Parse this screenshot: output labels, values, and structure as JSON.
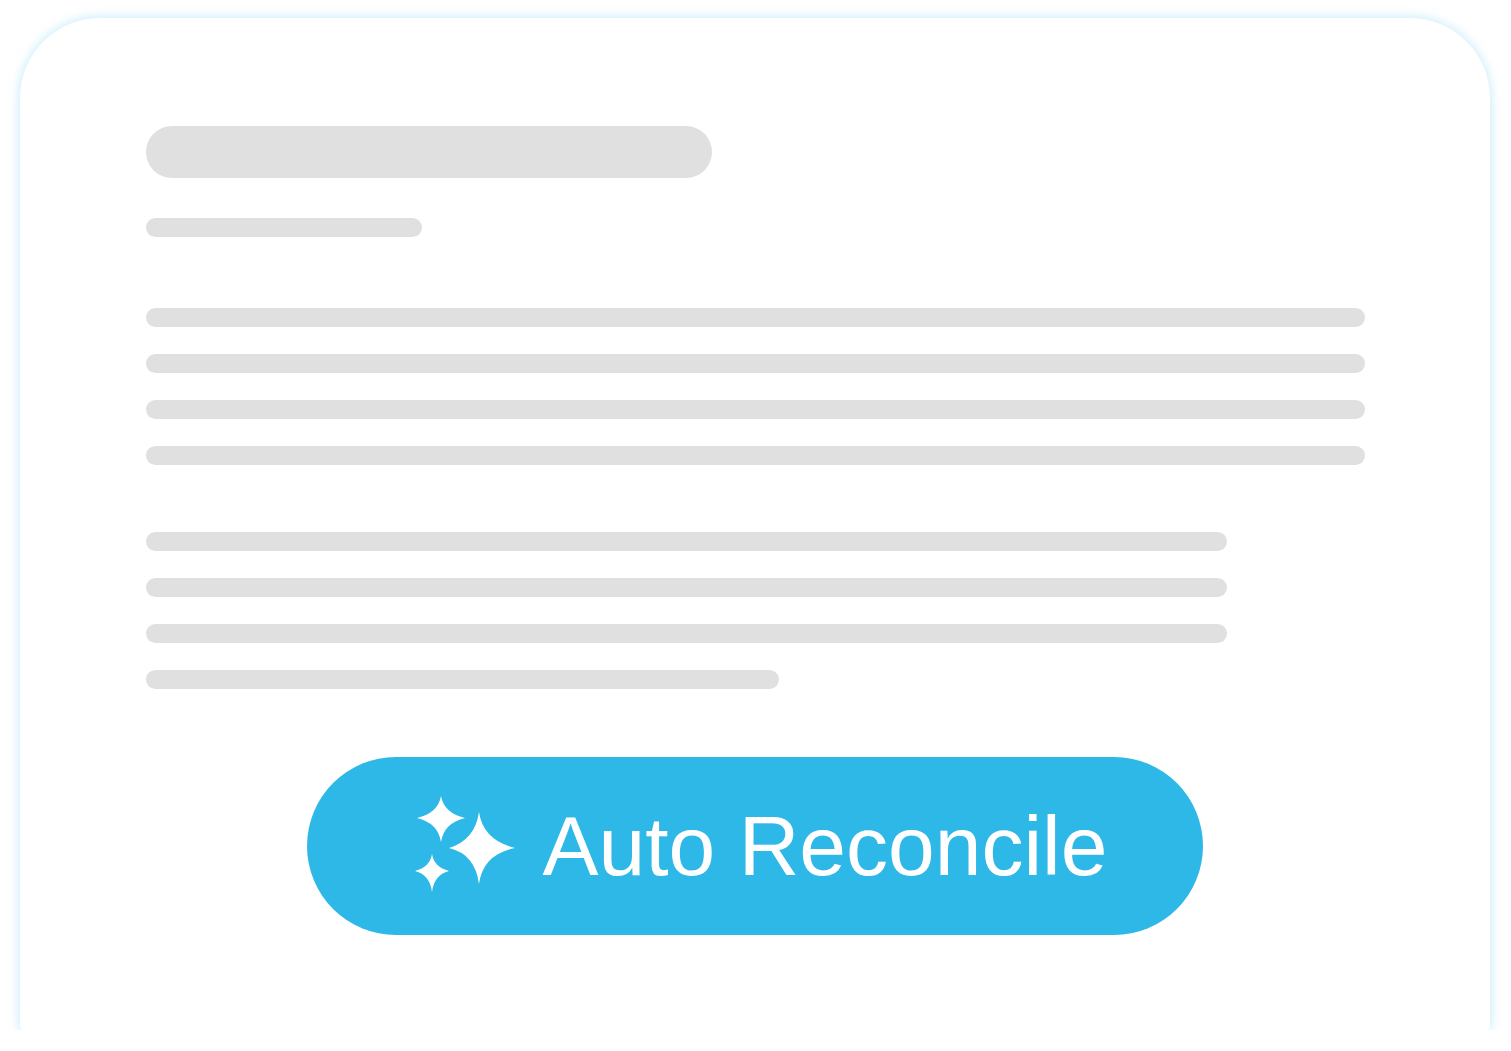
{
  "button": {
    "label": "Auto Reconcile"
  }
}
